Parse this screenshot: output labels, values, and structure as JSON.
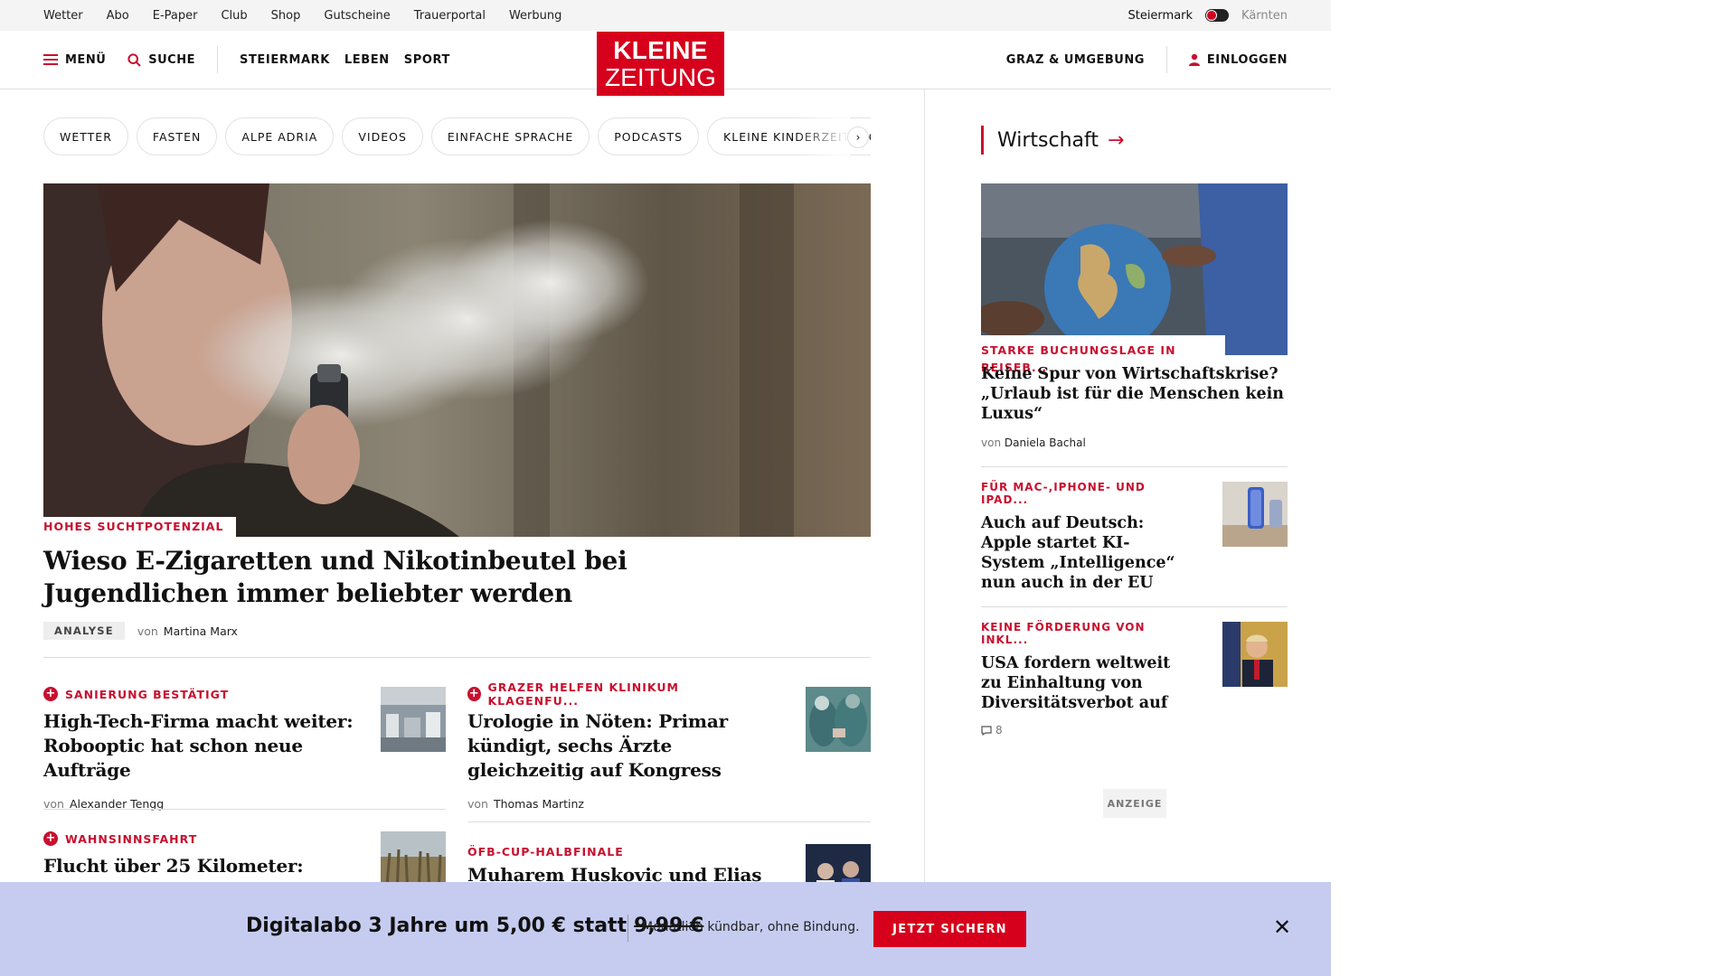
{
  "topbar": {
    "links": [
      "Wetter",
      "Abo",
      "E-Paper",
      "Club",
      "Shop",
      "Gutscheine",
      "Trauerportal",
      "Werbung"
    ],
    "region_active": "Steiermark",
    "region_other": "Kärnten"
  },
  "header": {
    "menu_label": "MENÜ",
    "search_label": "SUCHE",
    "nav": [
      "STEIERMARK",
      "LEBEN",
      "SPORT"
    ],
    "logo_line1": "KLEINE",
    "logo_line2": "ZEITUNG",
    "region_link": "GRAZ & UMGEBUNG",
    "login_label": "EINLOGGEN"
  },
  "chips": [
    "WETTER",
    "FASTEN",
    "ALPE ADRIA",
    "VIDEOS",
    "EINFACHE SPRACHE",
    "PODCASTS",
    "KLEINE KINDERZEITUNG"
  ],
  "hero": {
    "kicker": "HOHES SUCHTPOTENZIAL",
    "title": "Wieso E-Zigaretten und Nikotinbeutel bei Jugendlichen immer beliebter werden",
    "badge": "ANALYSE",
    "by": "von",
    "author": "Martina Marx"
  },
  "teasers": [
    {
      "kicker": "SANIERUNG BESTÄTIGT",
      "title": "High-Tech-Firma macht weiter: Robooptic hat schon neue Aufträge",
      "by": "von",
      "author": "Alexander Tengg"
    },
    {
      "kicker": "GRAZER HELFEN KLINIKUM KLAGENFU...",
      "title": "Urologie in Nöten: Primar kündigt, sechs Ärzte gleichzeitig auf Kongress",
      "by": "von",
      "author": "Thomas Martinz"
    },
    {
      "kicker": "WAHNSINNSFAHRT",
      "title": "Flucht über 25 Kilometer:"
    },
    {
      "kicker": "ÖFB-CUP-HALBFINALE",
      "title": "Muharem Huskovic und Elias"
    }
  ],
  "sidebar": {
    "section": "Wirtschaft",
    "articles": [
      {
        "kicker": "STARKE BUCHUNGSLAGE IN REISEB...",
        "title": "Keine Spur von Wirtschaftskrise? „Urlaub ist für die Menschen kein Luxus“",
        "by": "von",
        "author": "Daniela Bachal"
      },
      {
        "kicker": "FÜR MAC-,IPHONE- UND IPAD...",
        "title": "Auch auf Deutsch: Apple startet KI-System „Intelligence“ nun auch in der EU"
      },
      {
        "kicker": "KEINE FÖRDERUNG VON INKL...",
        "title": "USA fordern weltweit zu Einhaltung von Diversitätsverbot auf",
        "comments": "8"
      }
    ],
    "ad_label": "ANZEIGE"
  },
  "promo": {
    "offer": "Digitalabo 3 Jahre um 5,00 € statt",
    "old_price": "9,99 €",
    "sub": "Monatlich kündbar, ohne Bindung.",
    "cta": "JETZT SICHERN"
  },
  "colors": {
    "brand": "#d6001c",
    "kicker": "#c8102e",
    "promo_bg": "#c6ccf0"
  }
}
